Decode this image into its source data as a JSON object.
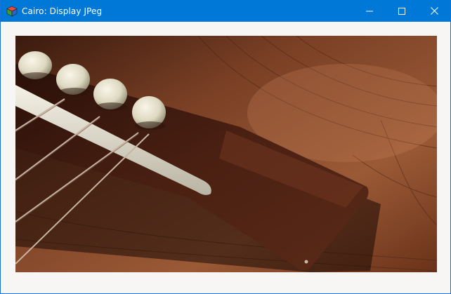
{
  "window": {
    "title": "Cairo: Display JPeg",
    "app_icon": "cairo-cube-icon",
    "controls": {
      "minimize": "minimize-icon",
      "maximize": "maximize-icon",
      "close": "close-icon"
    }
  },
  "colors": {
    "titlebar": "#0078d7",
    "client_background": "#f7f6f5"
  },
  "image": {
    "subject": "guitar-bridge-photo"
  }
}
